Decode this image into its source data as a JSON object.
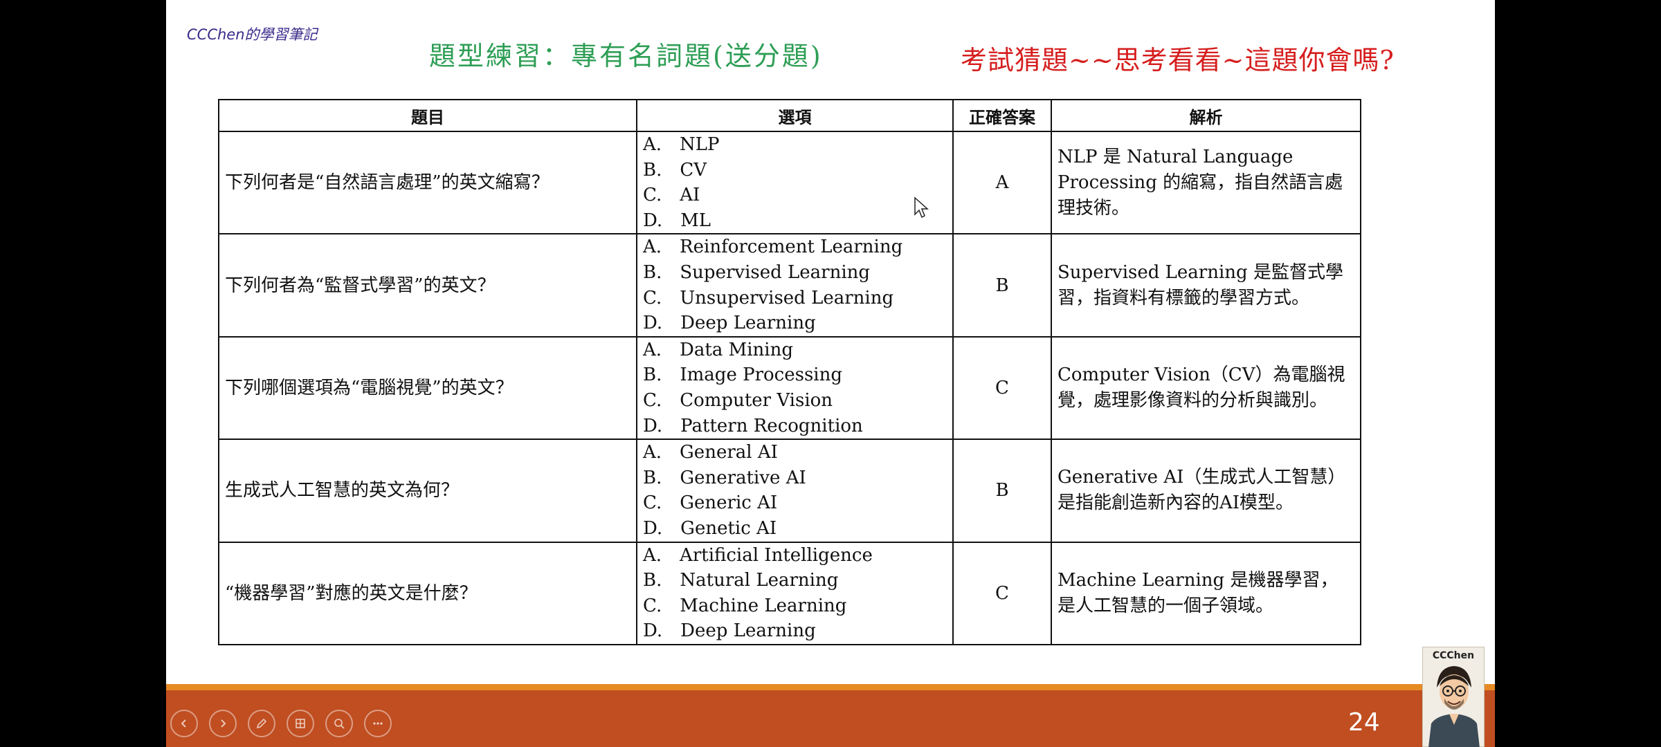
{
  "brand": "CCChen的學習筆記",
  "title_left": "題型練習：專有名詞題(送分題)",
  "title_right": "考試猜題~~思考看看~這題你會嗎?",
  "table": {
    "headers": [
      "題目",
      "選項",
      "正確答案",
      "解析"
    ],
    "rows": [
      {
        "question": "下列何者是“自然語言處理”的英文縮寫？",
        "options": [
          "A.　NLP",
          "B.　CV",
          "C.　AI",
          "D.　ML"
        ],
        "answer": "A",
        "explanation": "NLP 是 Natural Language Processing 的縮寫，指自然語言處理技術。"
      },
      {
        "question": "下列何者為“監督式學習”的英文？",
        "options": [
          "A.　Reinforcement Learning",
          "B.　Supervised Learning",
          "C.　Unsupervised Learning",
          "D.　Deep Learning"
        ],
        "answer": "B",
        "explanation": "Supervised Learning 是監督式學習，指資料有標籤的學習方式。"
      },
      {
        "question": "下列哪個選項為“電腦視覺”的英文？",
        "options": [
          "A.　Data Mining",
          "B.　Image Processing",
          "C.　Computer Vision",
          "D.　Pattern Recognition"
        ],
        "answer": "C",
        "explanation": "Computer Vision（CV）為電腦視覺，處理影像資料的分析與識別。"
      },
      {
        "question": "生成式人工智慧的英文為何？",
        "options": [
          "A.　General AI",
          "B.　Generative AI",
          "C.　Generic AI",
          "D.　Genetic AI"
        ],
        "answer": "B",
        "explanation": "Generative AI（生成式人工智慧）是指能創造新內容的AI模型。"
      },
      {
        "question": "“機器學習”對應的英文是什麼？",
        "options": [
          "A.　Artificial Intelligence",
          "B.　Natural Learning",
          "C.　Machine Learning",
          "D.　Deep Learning"
        ],
        "answer": "C",
        "explanation": "Machine Learning 是機器學習，是人工智慧的一個子領域。"
      }
    ]
  },
  "footer": {
    "page_number": "24",
    "controls": [
      "previous-icon",
      "next-icon",
      "pen-icon",
      "slides-icon",
      "zoom-icon",
      "more-icon"
    ],
    "avatar_label": "CCChen"
  },
  "colors": {
    "title_left": "#2e9e55",
    "title_right": "#d61d1d",
    "footer": "#c04e21",
    "footer_line": "#e68a24"
  }
}
